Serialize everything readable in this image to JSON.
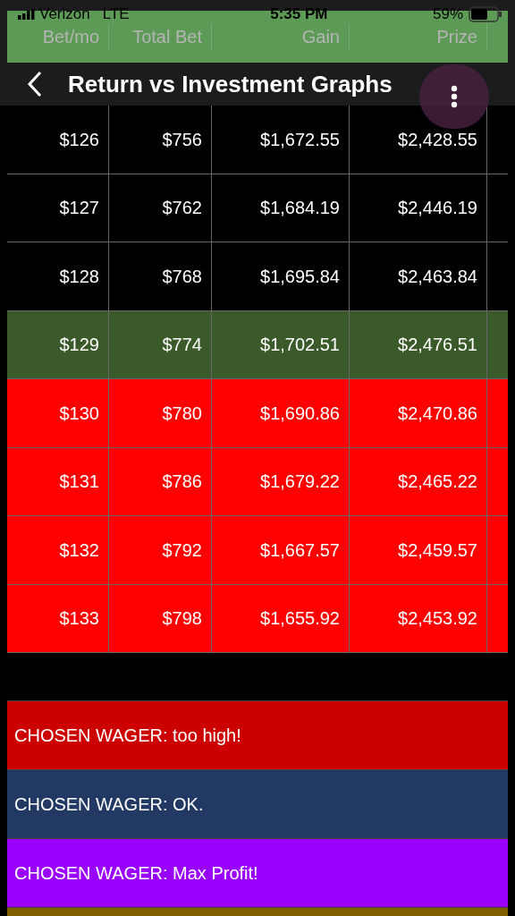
{
  "status_bar": {
    "carrier": "Verizon",
    "network": "LTE",
    "time": "5:35 PM",
    "battery": "59%"
  },
  "table": {
    "columns": [
      "Bet/mo",
      "Total Bet",
      "Gain",
      "Prize"
    ],
    "rows": [
      {
        "kind": "normal",
        "cells": [
          "$126",
          "$756",
          "$1,672.55",
          "$2,428.55"
        ]
      },
      {
        "kind": "normal",
        "cells": [
          "$127",
          "$762",
          "$1,684.19",
          "$2,446.19"
        ]
      },
      {
        "kind": "normal",
        "cells": [
          "$128",
          "$768",
          "$1,695.84",
          "$2,463.84"
        ]
      },
      {
        "kind": "best",
        "cells": [
          "$129",
          "$774",
          "$1,702.51",
          "$2,476.51"
        ]
      },
      {
        "kind": "over",
        "cells": [
          "$130",
          "$780",
          "$1,690.86",
          "$2,470.86"
        ]
      },
      {
        "kind": "over",
        "cells": [
          "$131",
          "$786",
          "$1,679.22",
          "$2,465.22"
        ]
      },
      {
        "kind": "over",
        "cells": [
          "$132",
          "$792",
          "$1,667.57",
          "$2,459.57"
        ]
      },
      {
        "kind": "over",
        "cells": [
          "$133",
          "$798",
          "$1,655.92",
          "$2,453.92"
        ]
      }
    ]
  },
  "nav_bar": {
    "title": "Return vs Investment Graphs"
  },
  "legend": [
    {
      "color": "#cc0000",
      "label": "CHOSEN WAGER: too high!"
    },
    {
      "color": "#223a63",
      "label": "CHOSEN WAGER: OK."
    },
    {
      "color": "#9900ff",
      "label": "CHOSEN WAGER: Max Profit!"
    },
    {
      "color": "#7f5f00"
    }
  ]
}
